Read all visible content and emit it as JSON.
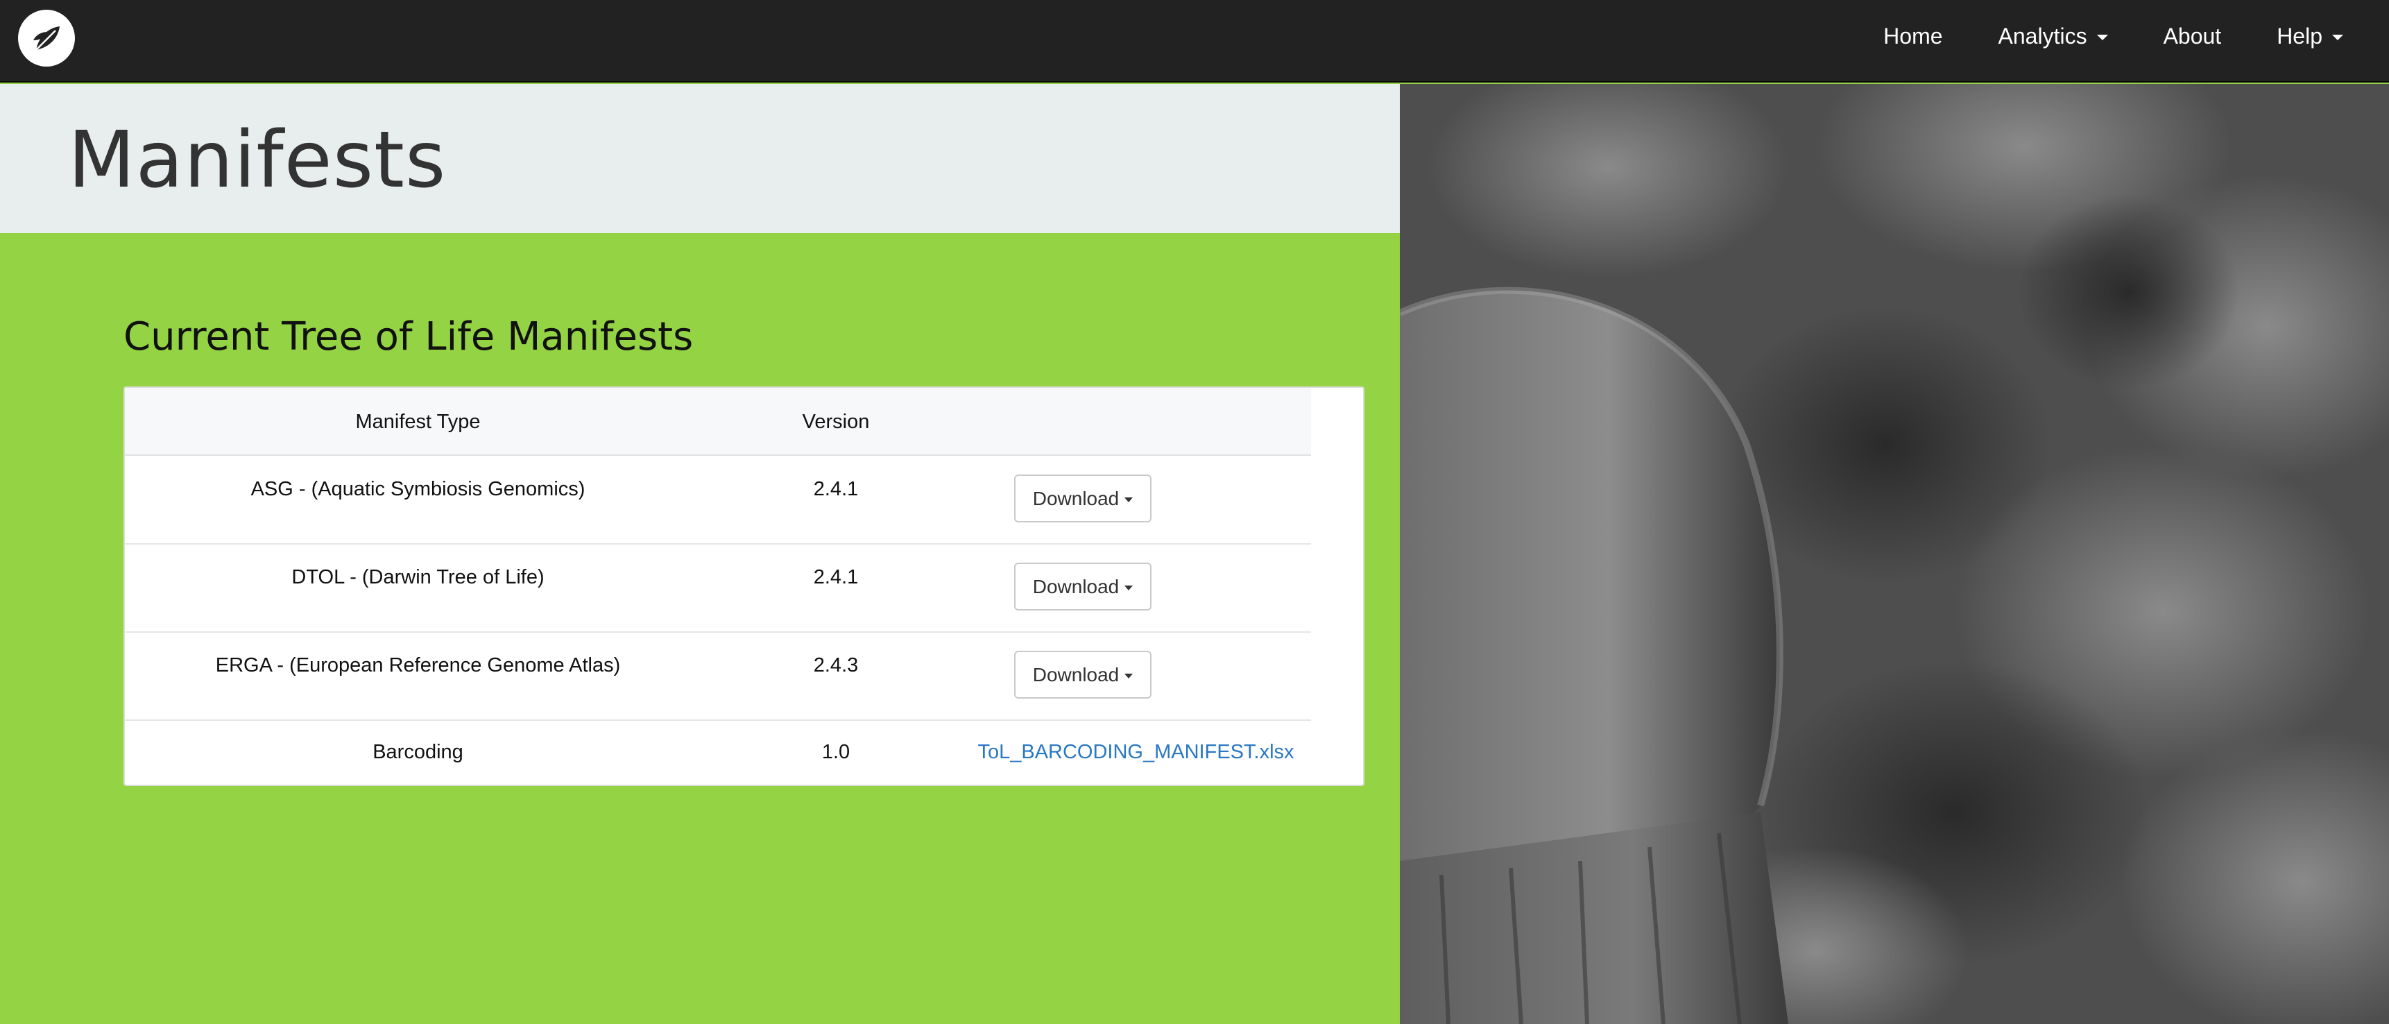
{
  "navbar": {
    "logo_icon": "leaf-logo-icon",
    "items": [
      {
        "label": "Home",
        "dropdown": false
      },
      {
        "label": "Analytics",
        "dropdown": true
      },
      {
        "label": "About",
        "dropdown": false
      },
      {
        "label": "Help",
        "dropdown": true
      }
    ]
  },
  "header": {
    "title": "Manifests"
  },
  "main": {
    "section_title": "Current Tree of Life Manifests",
    "table": {
      "columns": [
        "Manifest Type",
        "Version",
        ""
      ],
      "rows": [
        {
          "type": "ASG - (Aquatic Symbiosis Genomics)",
          "version": "2.4.1",
          "action": "Download"
        },
        {
          "type": "DTOL - (Darwin Tree of Life)",
          "version": "2.4.1",
          "action": "Download"
        },
        {
          "type": "ERGA - (European Reference Genome Atlas)",
          "version": "2.4.3",
          "action": "Download"
        },
        {
          "type": "Barcoding",
          "version": "1.0",
          "action": "ToL_BARCODING_MANIFEST.xlsx"
        }
      ]
    }
  },
  "colors": {
    "navbar_bg": "#222222",
    "header_bg": "#e8eeee",
    "content_bg": "#94d344",
    "link": "#2a78c2"
  }
}
